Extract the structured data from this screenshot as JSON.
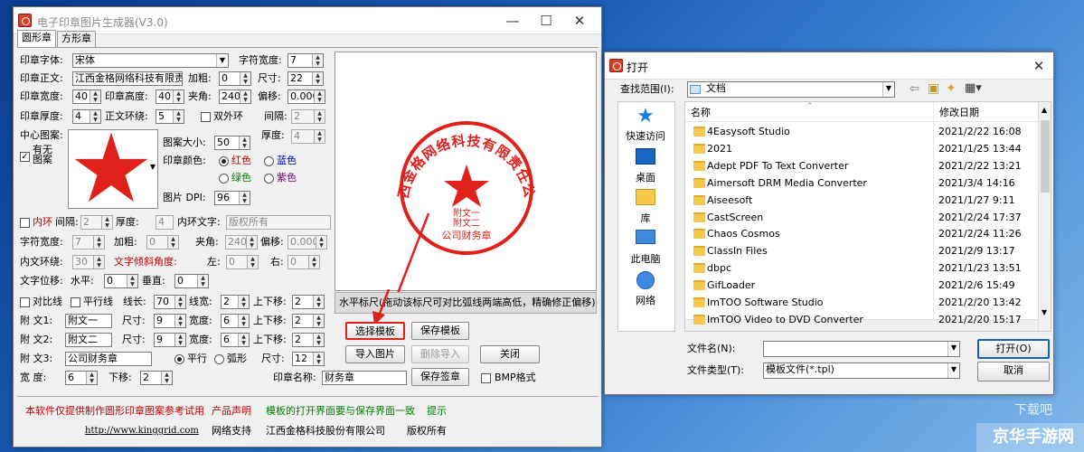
{
  "generator": {
    "title": "电子印章图片生成器(V3.0)",
    "controls": {
      "min": "—",
      "max": "☐",
      "close": "✕"
    },
    "tabs": [
      "圆形章",
      "方形章"
    ],
    "labels": {
      "font": "印章字体:",
      "char_width": "字符宽度:",
      "text": "印章正文:",
      "bold": "加粗:",
      "size": "尺寸:",
      "seal_width": "印章宽度:",
      "seal_height": "印章高度:",
      "angle": "夹角:",
      "offset": "偏移:",
      "thickness": "印章厚度:",
      "ring": "正文环绕:",
      "double_ring": "双外环",
      "gap": "间隔:",
      "center_pic": "中心图案:",
      "has_pic": "有无图案",
      "pic_size": "图案大小:",
      "thick2": "厚度:",
      "color": "印章颜色:",
      "red": "红色",
      "blue": "蓝色",
      "green": "绿色",
      "purple": "紫色",
      "dpi": "图片 DPI:",
      "inner_ring": "内环",
      "inner_gap": "间隔:",
      "inner_thick": "厚度:",
      "inner_text": "内环文字:",
      "char_width2": "字符宽度:",
      "bold2": "加粗:",
      "angle2": "夹角:",
      "offset2": "偏移:",
      "inner_wrap": "内文环绕:",
      "tilt": "文字倾斜角度:",
      "left": "左:",
      "right": "右:",
      "shift": "文字位移:",
      "horiz": "水平:",
      "vert": "垂直:",
      "line": "对比线",
      "parallel": "平行线",
      "line_len": "线长:",
      "line_w": "线宽:",
      "updown": "上下移:",
      "ann1": "附  文1:",
      "ann2": "附  文2:",
      "ann3": "附  文3:",
      "size_a": "尺寸:",
      "width_a": "宽度:",
      "updown_a": "上下移:",
      "flat": "平行",
      "arc": "弧形",
      "width": "宽  度:",
      "down": "下移:",
      "seal_name": "印章名称:",
      "bmp": "BMP格式"
    },
    "values": {
      "font": "宋体",
      "char_width": "7",
      "text": "江西金格网络科技有限责",
      "bold": "0",
      "size": "22",
      "seal_width": "40",
      "seal_height": "40",
      "angle": "240",
      "offset": "0.000",
      "thickness": "4",
      "ring": "5",
      "gap": "2",
      "pic_size": "50",
      "thick2": "4",
      "dpi": "96",
      "inner_gap": "2",
      "inner_thick": "4",
      "inner_text": "版权所有",
      "char_width2": "7",
      "bold2": "0",
      "angle2": "240",
      "offset2": "0.000",
      "inner_wrap": "30",
      "left": "0",
      "right": "0",
      "horiz": "0",
      "vert": "0",
      "line_len": "70",
      "line_w": "2",
      "updown": "2",
      "ann1": "附文一",
      "ann1_size": "9",
      "ann1_w": "6",
      "ann1_ud": "2",
      "ann2": "附文二",
      "ann2_size": "9",
      "ann2_w": "6",
      "ann2_ud": "2",
      "ann3": "公司财务章",
      "ann3_size": "12",
      "width": "6",
      "down": "2",
      "seal_name": "财务章"
    },
    "ruler_text": "水平标尺(拖动该标尺可对比弧线两端高低，精确修正偏移)",
    "buttons": {
      "select": "选择模板",
      "save_tpl": "保存模板",
      "import": "导入图片",
      "delete_import": "删除导入",
      "close": "关闭",
      "save_seal": "保存签章"
    },
    "seal": {
      "ring_text": "江西金格网络科技有限责任公司",
      "ann1": "附文一",
      "ann2": "附文二",
      "ann3": "公司财务章",
      "color": "#e0201b"
    },
    "footer": {
      "notice": "本软件仅提供制作圆形印章图案参考试用",
      "product": "产品声明",
      "note": "模板的打开界面要与保存界面一致",
      "tip": "提示",
      "url": "http://www.kinggrid.com",
      "support": "网络支持",
      "company": "江西金格科技股份有限公司",
      "rights": "版权所有"
    }
  },
  "dialog": {
    "title": "打开",
    "look_in_label": "查找范围(I):",
    "look_in_value": "文档",
    "nav": [
      "快速访问",
      "桌面",
      "库",
      "此电脑",
      "网络"
    ],
    "columns": {
      "name": "名称",
      "date": "修改日期"
    },
    "files": [
      {
        "name": "4Easysoft Studio",
        "date": "2021/2/22 16:08"
      },
      {
        "name": "2021",
        "date": "2021/1/25 13:44"
      },
      {
        "name": "Adept PDF To Text Converter",
        "date": "2021/2/22 13:21"
      },
      {
        "name": "Aimersoft DRM Media Converter",
        "date": "2021/3/4 14:16"
      },
      {
        "name": "Aiseesoft",
        "date": "2021/1/27 9:11"
      },
      {
        "name": "CastScreen",
        "date": "2021/2/24 17:37"
      },
      {
        "name": "Chaos Cosmos",
        "date": "2021/2/24 11:26"
      },
      {
        "name": "ClassIn Files",
        "date": "2021/2/9 13:17"
      },
      {
        "name": "dbpc",
        "date": "2021/1/23 13:51"
      },
      {
        "name": "GifLoader",
        "date": "2021/2/6 15:49"
      },
      {
        "name": "ImTOO Software Studio",
        "date": "2021/2/20 13:42"
      },
      {
        "name": "ImTOO Video to DVD Converter",
        "date": "2021/2/20 15:17"
      }
    ],
    "filename_label": "文件名(N):",
    "filename_value": "",
    "filetype_label": "文件类型(T):",
    "filetype_value": "模板文件(*.tpl)",
    "open": "打开(O)",
    "cancel": "取消"
  },
  "watermark": {
    "brand": "京华手游网",
    "small": "下载吧"
  }
}
